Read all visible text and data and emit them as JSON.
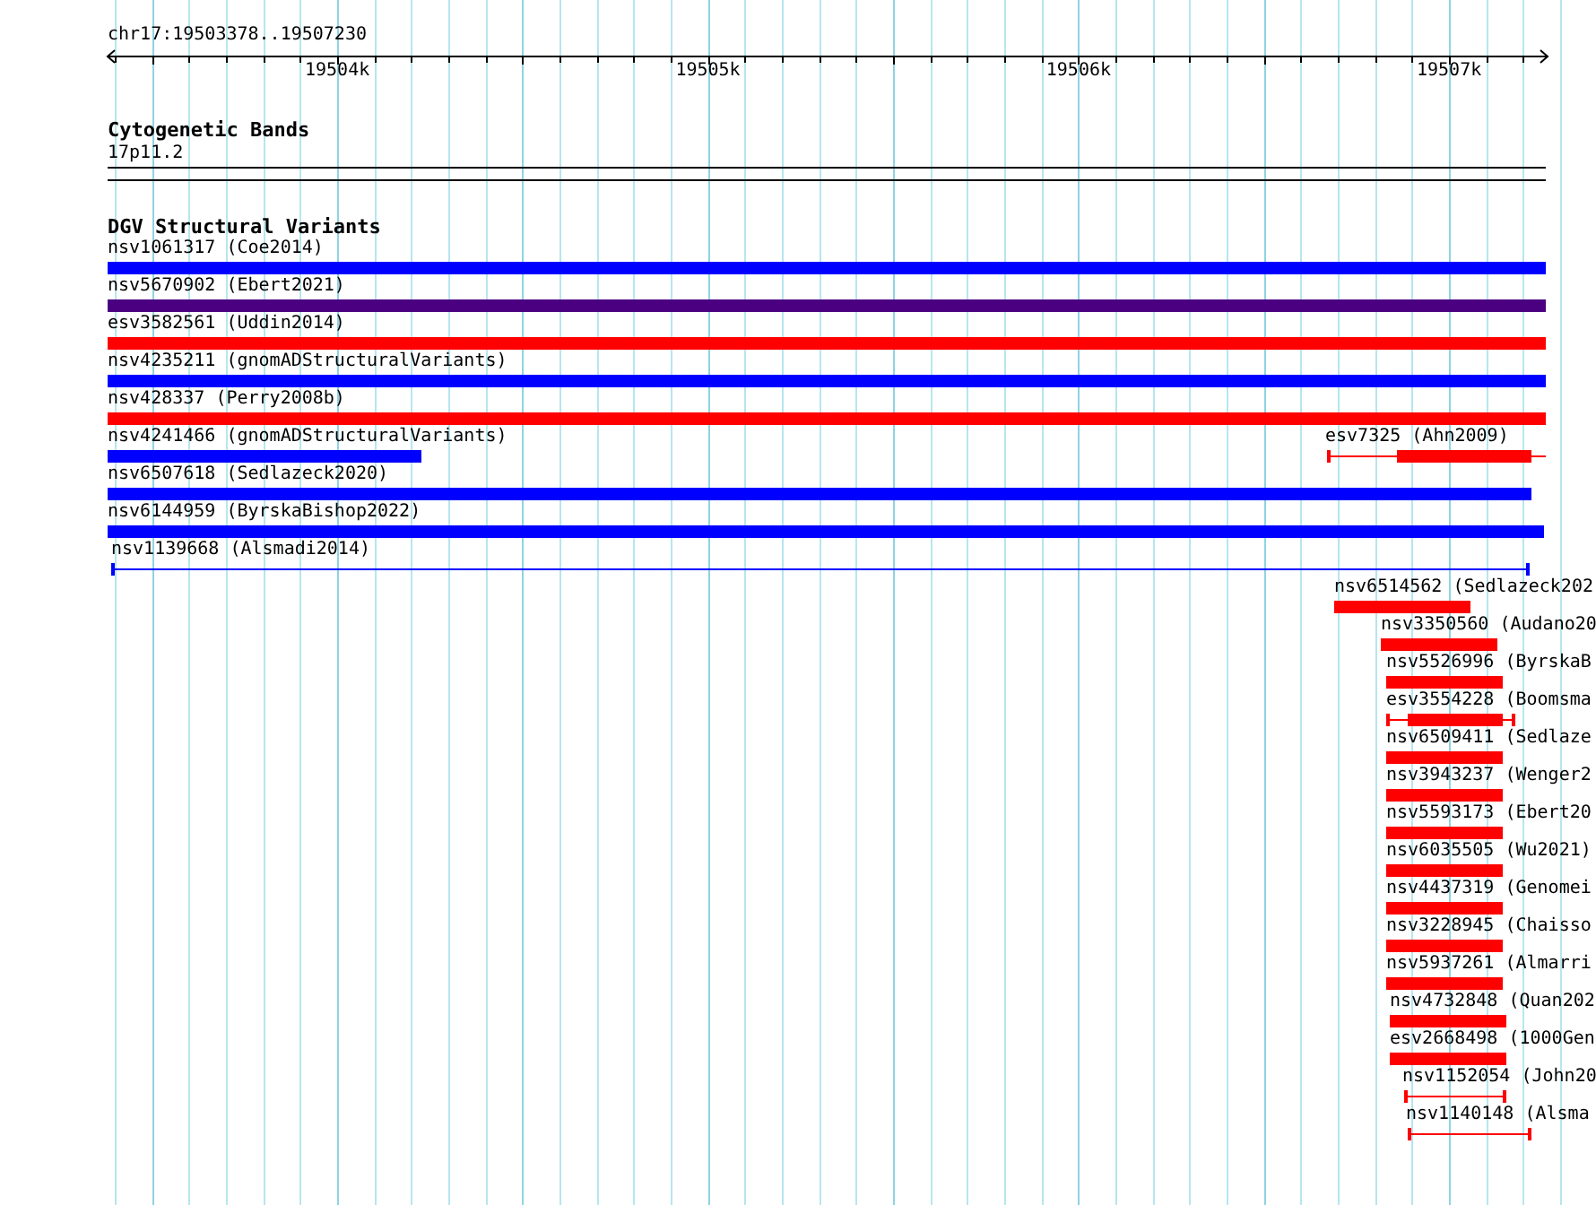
{
  "ruler": {
    "location": "chr17:19503378..19507230",
    "ticks": [
      "19504k",
      "19505k",
      "19506k",
      "19507k"
    ]
  },
  "cytogenetic_track": {
    "title": "Cytogenetic Bands",
    "bands": [
      {
        "name": "17p11.2"
      }
    ]
  },
  "dgv_track": {
    "title": "DGV Structural Variants",
    "features": [
      {
        "label": "nsv1061317 (Coe2014)",
        "color": "#0000ff",
        "kind": "bar"
      },
      {
        "label": "nsv5670902 (Ebert2021)",
        "color": "#4b0082",
        "kind": "bar"
      },
      {
        "label": "esv3582561 (Uddin2014)",
        "color": "#ff0000",
        "kind": "bar"
      },
      {
        "label": "nsv4235211 (gnomADStructuralVariants)",
        "color": "#0000ff",
        "kind": "bar"
      },
      {
        "label": "nsv428337 (Perry2008b)",
        "color": "#ff0000",
        "kind": "bar"
      },
      {
        "label": "nsv4241466 (gnomADStructuralVariants)",
        "color": "#0000ff",
        "kind": "bar"
      },
      {
        "label": "esv7325 (Ahn2009)",
        "color": "#ff0000",
        "kind": "split"
      },
      {
        "label": "nsv6507618 (Sedlazeck2020)",
        "color": "#0000ff",
        "kind": "bar"
      },
      {
        "label": "nsv6144959 (ByrskaBishop2022)",
        "color": "#0000ff",
        "kind": "bar"
      },
      {
        "label": "nsv1139668 (Alsmadi2014)",
        "color": "#0000ff",
        "kind": "line"
      },
      {
        "label": "nsv6514562 (Sedlazeck202",
        "color": "#ff0000",
        "kind": "bar"
      },
      {
        "label": "nsv3350560 (Audano20",
        "color": "#ff0000",
        "kind": "bar"
      },
      {
        "label": "nsv5526996 (ByrskaB",
        "color": "#ff0000",
        "kind": "bar"
      },
      {
        "label": "esv3554228 (Boomsma",
        "color": "#ff0000",
        "kind": "split"
      },
      {
        "label": "nsv6509411 (Sedlaze",
        "color": "#ff0000",
        "kind": "bar"
      },
      {
        "label": "nsv3943237 (Wenger2",
        "color": "#ff0000",
        "kind": "bar"
      },
      {
        "label": "nsv5593173 (Ebert20",
        "color": "#ff0000",
        "kind": "bar"
      },
      {
        "label": "nsv6035505 (Wu2021)",
        "color": "#ff0000",
        "kind": "bar"
      },
      {
        "label": "nsv4437319 (Genomei",
        "color": "#ff0000",
        "kind": "bar"
      },
      {
        "label": "nsv3228945 (Chaisso",
        "color": "#ff0000",
        "kind": "bar"
      },
      {
        "label": "nsv5937261 (Almarri",
        "color": "#ff0000",
        "kind": "bar"
      },
      {
        "label": "nsv4732848 (Quan202",
        "color": "#ff0000",
        "kind": "bar"
      },
      {
        "label": "esv2668498 (1000Gen",
        "color": "#ff0000",
        "kind": "bar"
      },
      {
        "label": "nsv1152054 (John20",
        "color": "#ff0000",
        "kind": "line"
      },
      {
        "label": "nsv1140148 (Alsma",
        "color": "#ff0000",
        "kind": "line"
      }
    ]
  }
}
